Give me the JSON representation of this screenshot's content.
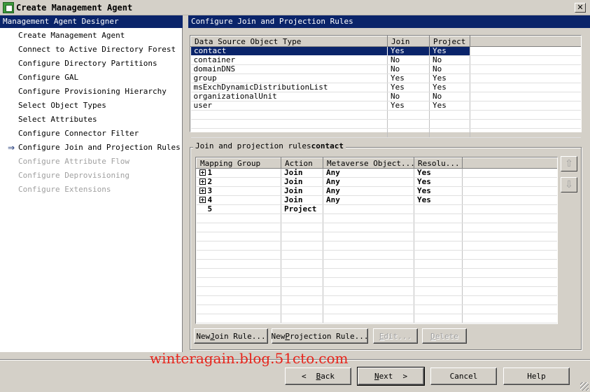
{
  "window": {
    "title": "Create Management Agent",
    "close_glyph": "✕"
  },
  "left_panel": {
    "header": "Management Agent Designer",
    "items": [
      {
        "label": "Create Management Agent",
        "state": "done"
      },
      {
        "label": "Connect to Active Directory Forest",
        "state": "done"
      },
      {
        "label": "Configure Directory Partitions",
        "state": "done"
      },
      {
        "label": "Configure GAL",
        "state": "done"
      },
      {
        "label": "Configure Provisioning Hierarchy",
        "state": "done"
      },
      {
        "label": "Select Object Types",
        "state": "done"
      },
      {
        "label": "Select Attributes",
        "state": "done"
      },
      {
        "label": "Configure Connector Filter",
        "state": "done"
      },
      {
        "label": "Configure Join and Projection Rules",
        "state": "current"
      },
      {
        "label": "Configure Attribute Flow",
        "state": "disabled"
      },
      {
        "label": "Configure Deprovisioning",
        "state": "disabled"
      },
      {
        "label": "Configure Extensions",
        "state": "disabled"
      }
    ]
  },
  "right_panel": {
    "header": "Configure Join and Projection Rules",
    "object_types": {
      "columns": [
        "Data Source Object Type",
        "Join",
        "Project"
      ],
      "rows": [
        {
          "type": "contact",
          "join": "Yes",
          "project": "Yes",
          "selected": true
        },
        {
          "type": "container",
          "join": "No",
          "project": "No"
        },
        {
          "type": "domainDNS",
          "join": "No",
          "project": "No"
        },
        {
          "type": "group",
          "join": "Yes",
          "project": "Yes"
        },
        {
          "type": "msExchDynamicDistributionList",
          "join": "Yes",
          "project": "Yes"
        },
        {
          "type": "organizationalUnit",
          "join": "No",
          "project": "No"
        },
        {
          "type": "user",
          "join": "Yes",
          "project": "Yes"
        }
      ]
    },
    "rules_group": {
      "title_prefix": "Join and projection rules",
      "title_object": "contact",
      "columns": [
        "Mapping Group",
        "Action",
        "Metaverse Object...",
        "Resolu..."
      ],
      "rows": [
        {
          "group": "1",
          "action": "Join",
          "metaverse": "Any",
          "resolution": "Yes",
          "expandable": true
        },
        {
          "group": "2",
          "action": "Join",
          "metaverse": "Any",
          "resolution": "Yes",
          "expandable": true
        },
        {
          "group": "3",
          "action": "Join",
          "metaverse": "Any",
          "resolution": "Yes",
          "expandable": true
        },
        {
          "group": "4",
          "action": "Join",
          "metaverse": "Any",
          "resolution": "Yes",
          "expandable": true
        },
        {
          "group": "5",
          "action": "Project",
          "metaverse": "",
          "resolution": "",
          "expandable": false
        }
      ],
      "buttons": {
        "new_join": {
          "before": "New ",
          "underlined": "J",
          "after": "oin Rule..."
        },
        "new_projection": {
          "before": "New ",
          "underlined": "P",
          "after": "rojection Rule..."
        },
        "edit": {
          "underlined": "E",
          "after": "dit..."
        },
        "delete": {
          "underlined": "D",
          "after": "elete"
        }
      },
      "move_up_glyph": "⇧",
      "move_down_glyph": "⇩"
    }
  },
  "footer": {
    "watermark": "winteragain.blog.51cto.com",
    "back": {
      "glyph": "<",
      "underlined": "B",
      "after": "ack"
    },
    "next": {
      "underlined": "N",
      "after": "ext",
      "glyph": ">"
    },
    "cancel": "Cancel",
    "help": "Help"
  }
}
